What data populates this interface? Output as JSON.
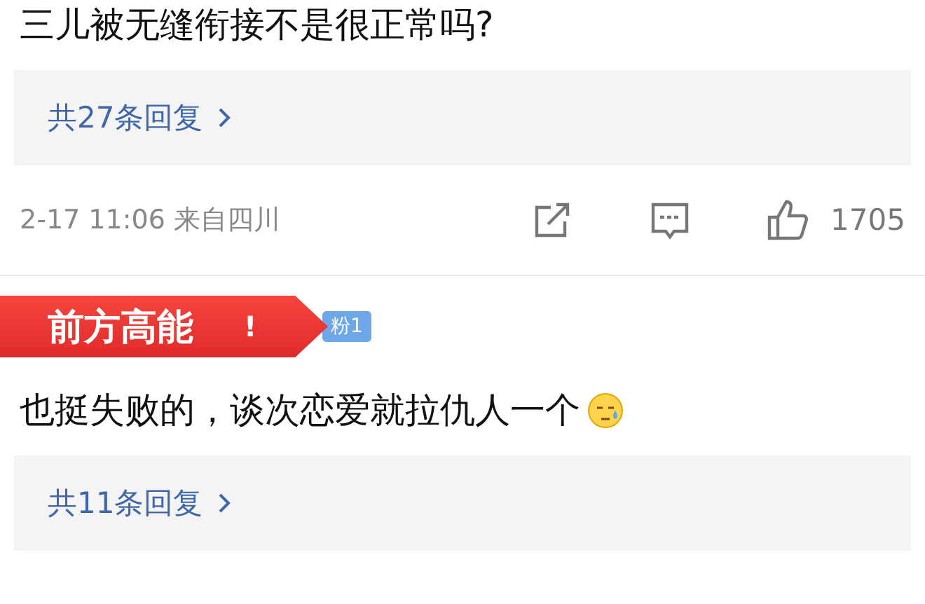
{
  "comments": [
    {
      "text": "三儿被无缝衔接不是很正常吗?",
      "reply_link": "共27条回复",
      "meta": {
        "time": "2-17 11:06",
        "location": "来自四川",
        "likes": "1705"
      }
    },
    {
      "sticker": {
        "title": "前方高能",
        "mark": "!"
      },
      "fan_badge": "粉1",
      "text": "也挺失败的，谈次恋爱就拉仇人一个",
      "emoji": true,
      "reply_link": "共11条回复"
    }
  ]
}
